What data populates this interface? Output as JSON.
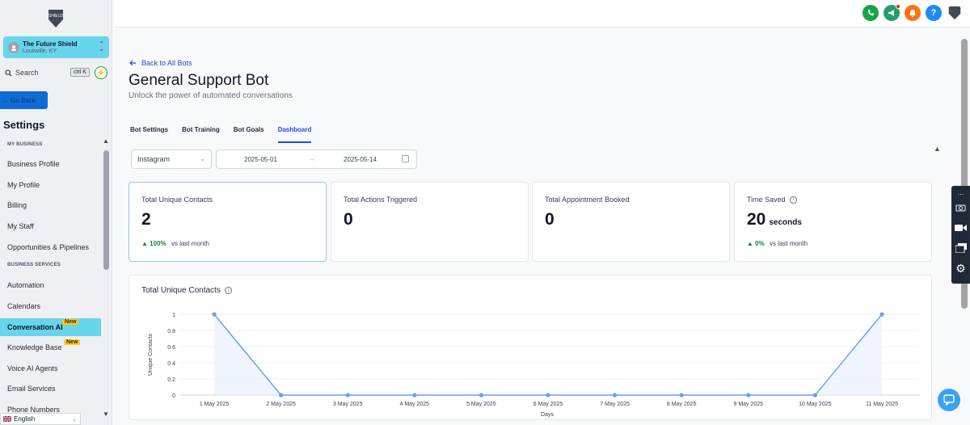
{
  "sidebar": {
    "logo_text": "SHIELD",
    "location_name": "The Future Shield",
    "location_city": "Louisville, KY",
    "search_label": "Search",
    "search_shortcut": "ctrl K",
    "go_back_label": "← Go Back",
    "settings_title": "Settings",
    "section_business": "MY BUSINESS",
    "section_services": "BUSINESS SERVICES",
    "items_business": [
      "Business Profile",
      "My Profile",
      "Billing",
      "My Staff",
      "Opportunities & Pipelines"
    ],
    "items_services": [
      "Automation",
      "Calendars",
      "Conversation AI",
      "Knowledge Base",
      "Voice AI Agents",
      "Email Services",
      "Phone Numbers"
    ],
    "new_badge": "New",
    "language": "English"
  },
  "topbar": {
    "icons": [
      "phone-icon",
      "megaphone-icon",
      "bell-icon",
      "help-icon",
      "shield-avatar-icon"
    ],
    "colors": {
      "phone": "#16a34a",
      "megaphone": "#22a06b",
      "bell": "#f97316",
      "help": "#1d8cf8",
      "avatar": "#374151"
    }
  },
  "header": {
    "back_link": "Back to All Bots",
    "title": "General Support Bot",
    "subtitle": "Unlock the power of automated conversations"
  },
  "tabs": [
    "Bot Settings",
    "Bot Training",
    "Bot Goals",
    "Dashboard"
  ],
  "active_tab": "Dashboard",
  "filters": {
    "channel": "Instagram",
    "date_start": "2025-05-01",
    "date_end": "2025-05-14"
  },
  "cards": [
    {
      "label": "Total Unique Contacts",
      "value": "2",
      "unit": "",
      "change": "100%",
      "change_suffix": "vs last month"
    },
    {
      "label": "Total Actions Triggered",
      "value": "0",
      "unit": "",
      "change": "",
      "change_suffix": ""
    },
    {
      "label": "Total Appointment Booked",
      "value": "0",
      "unit": "",
      "change": "",
      "change_suffix": ""
    },
    {
      "label": "Time Saved",
      "value": "20",
      "unit": "seconds",
      "change": "0%",
      "change_suffix": "vs last month"
    }
  ],
  "chart_title": "Total Unique Contacts",
  "chart_data": {
    "type": "line",
    "title": "Total Unique Contacts",
    "xlabel": "Days",
    "ylabel": "Unique Contacts",
    "categories": [
      "1 May 2025",
      "2 May 2025",
      "3 May 2025",
      "4 May 2025",
      "5 May 2025",
      "6 May 2025",
      "7 May 2025",
      "8 May 2025",
      "9 May 2025",
      "10 May 2025",
      "11 May 2025"
    ],
    "values": [
      1,
      0,
      0,
      0,
      0,
      0,
      0,
      0,
      0,
      0,
      1
    ],
    "yticks": [
      "0",
      "0.2",
      "0.4",
      "0.6",
      "0.8",
      "1"
    ],
    "ylim": [
      0,
      1
    ],
    "grid": true,
    "line_color": "#6b9cf0"
  }
}
